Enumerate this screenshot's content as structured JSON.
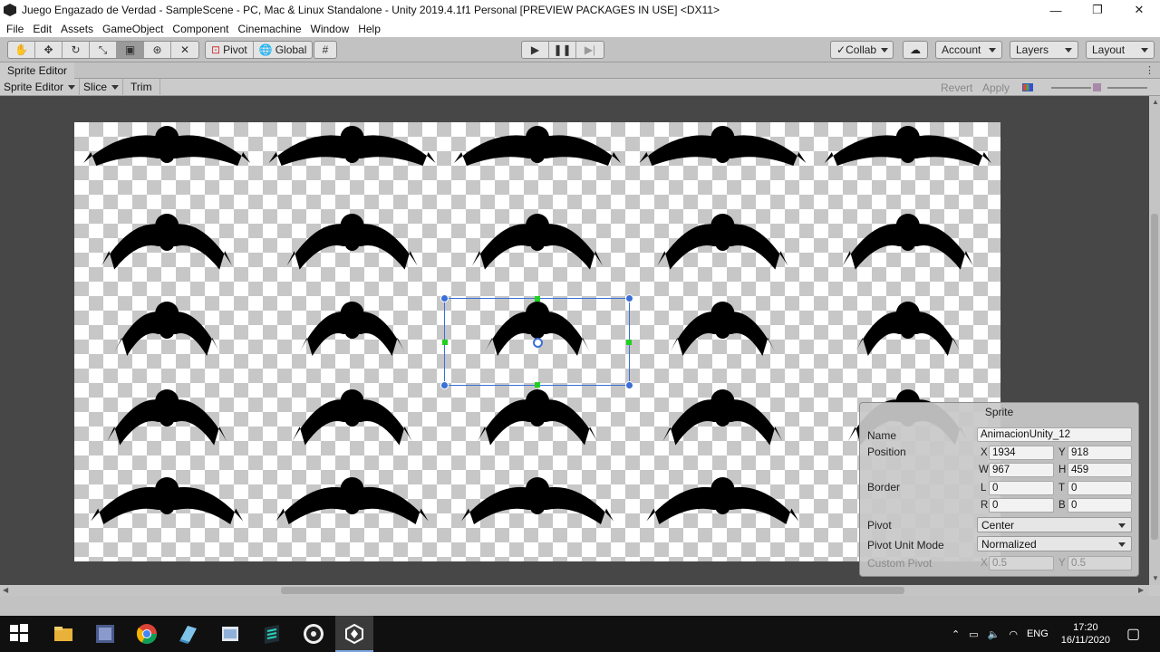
{
  "titlebar": {
    "title": "Juego Engazado de Verdad - SampleScene - PC, Mac & Linux Standalone - Unity 2019.4.1f1 Personal [PREVIEW PACKAGES IN USE] <DX11>",
    "minimize": "—",
    "maximize": "❐",
    "close": "✕"
  },
  "menubar": {
    "items": [
      "File",
      "Edit",
      "Assets",
      "GameObject",
      "Component",
      "Cinemachine",
      "Window",
      "Help"
    ]
  },
  "toolbar": {
    "tools": [
      "hand-tool",
      "move-tool",
      "rotate-tool",
      "scale-tool",
      "rect-tool",
      "transform-tool",
      "custom-tool"
    ],
    "pivot_label": "Pivot",
    "global_label": "Global",
    "collab_label": "Collab",
    "account_label": "Account",
    "layers_label": "Layers",
    "layout_label": "Layout"
  },
  "sprite_editor": {
    "tab_title": "Sprite Editor",
    "mode_label": "Sprite Editor",
    "slice_label": "Slice",
    "trim_label": "Trim",
    "revert_label": "Revert",
    "apply_label": "Apply"
  },
  "sprite_panel": {
    "header": "Sprite",
    "name_label": "Name",
    "name_value": "AnimacionUnity_12",
    "position_label": "Position",
    "x_label": "X",
    "x_value": "1934",
    "y_label": "Y",
    "y_value": "918",
    "w_label": "W",
    "w_value": "967",
    "h_label": "H",
    "h_value": "459",
    "border_label": "Border",
    "l_label": "L",
    "l_value": "0",
    "t_label": "T",
    "t_value": "0",
    "r_label": "R",
    "r_value": "0",
    "b_label": "B",
    "b_value": "0",
    "pivot_label": "Pivot",
    "pivot_value": "Center",
    "pivot_unit_label": "Pivot Unit Mode",
    "pivot_unit_value": "Normalized",
    "custom_pivot_label": "Custom Pivot",
    "cx_label": "X",
    "cx_value": "0.5",
    "cy_label": "Y",
    "cy_value": "0.5"
  },
  "taskbar": {
    "apps": [
      "file-explorer",
      "unity-hub",
      "chrome",
      "notepad",
      "paint",
      "sublime",
      "obs",
      "unity"
    ],
    "language": "ENG",
    "time": "17:20",
    "date": "16/11/2020"
  },
  "colors": {
    "selection": "#3a6fd8",
    "handle_green": "#20d020",
    "canvas_bg": "#474747",
    "sprite_fill": "#000000"
  }
}
